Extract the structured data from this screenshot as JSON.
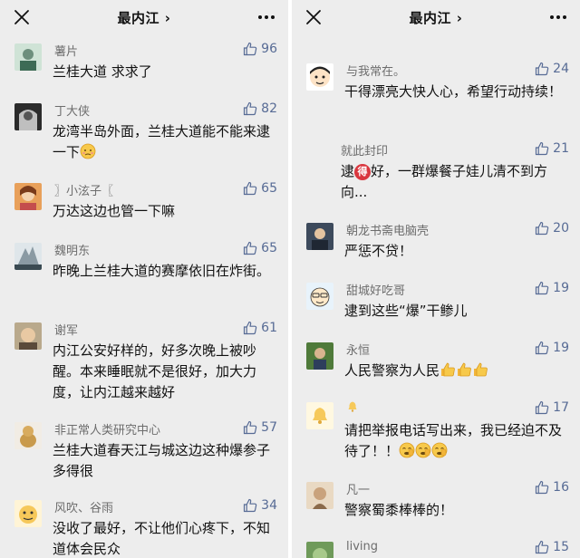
{
  "left": {
    "title": "最内江 ›",
    "comments": [
      {
        "name": "薯片",
        "likes": "96",
        "text": "兰桂大道 求求了"
      },
      {
        "name": "丁大侠",
        "likes": "82",
        "text": "龙湾半岛外面，兰桂大道能不能来逮一下"
      },
      {
        "name": "〗小泫子〖",
        "likes": "65",
        "text": "万达这边也管一下嘛"
      },
      {
        "name": "魏明东",
        "likes": "65",
        "text": "昨晚上兰桂大道的赛摩依旧在炸街。"
      },
      {
        "name": "谢军",
        "likes": "61",
        "text": "内江公安好样的，好多次晚上被吵醒。本来睡眠就不是很好，加大力度，让内江越来越好"
      },
      {
        "name": "非正常人类研究中心",
        "likes": "57",
        "text": "兰桂大道春天江与城这边这种爆参子多得很"
      },
      {
        "name": "风吹、谷雨",
        "likes": "34",
        "text": "没收了最好，不让他们心疼下，不知道体会民众"
      }
    ]
  },
  "right": {
    "title": "最内江 ›",
    "comments": [
      {
        "name": "与我常在。",
        "likes": "24",
        "text": "干得漂亮大快人心，希望行动持续！"
      },
      {
        "name": "就此封印",
        "likes": "21",
        "text_before": "逮",
        "badge": "得",
        "text_after": "好，一群爆餐子娃儿清不到方向..."
      },
      {
        "name": "朝龙书斋电脑壳",
        "likes": "20",
        "text": "严惩不贷！"
      },
      {
        "name": "甜城好吃哥",
        "likes": "19",
        "text": "逮到这些“爆”干鲹儿"
      },
      {
        "name": "永恒",
        "likes": "19",
        "text": "人民警察为人民"
      },
      {
        "name": "",
        "likes": "17",
        "text": "请把举报电话写出来，我已经迫不及待了！！"
      },
      {
        "name": "凡一",
        "likes": "16",
        "text": "警察蜀黍棒棒的！"
      },
      {
        "name": "living",
        "likes": "15",
        "text": ""
      }
    ]
  },
  "colors": {
    "panel_bg": "#ededed",
    "like_blue": "#576b95",
    "name_gray": "#6d6d6d"
  },
  "icons": [
    "close-icon",
    "more-icon",
    "thumbs-up-icon",
    "thumbs-up-emoji",
    "facepalm-emoji",
    "awkward-emoji",
    "bell-icon"
  ]
}
